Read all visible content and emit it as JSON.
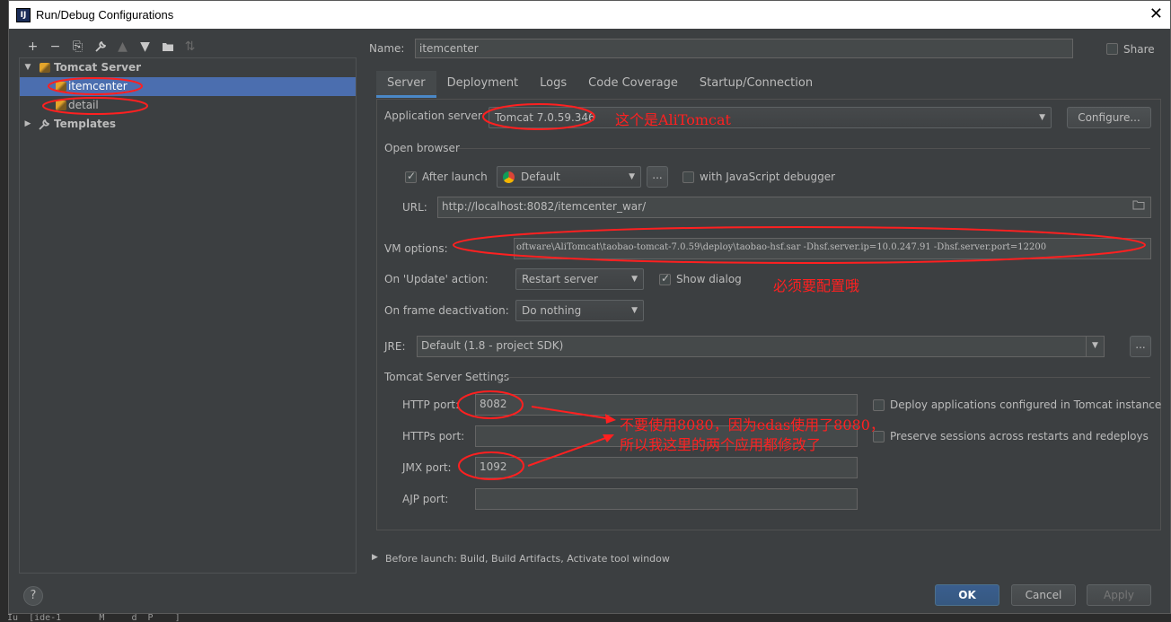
{
  "window": {
    "title": "Run/Debug Configurations",
    "close_glyph": "✕"
  },
  "left_toolbar": [
    "+",
    "−",
    "⎘",
    "🔧",
    "▲",
    "▼",
    "📁",
    "⇅"
  ],
  "tree": {
    "group_label": "Tomcat Server",
    "items": [
      {
        "label": "itemcenter",
        "selected": true
      },
      {
        "label": "detail",
        "selected": false
      }
    ],
    "templates_label": "Templates"
  },
  "name": {
    "label": "Name:",
    "value": "itemcenter"
  },
  "share": {
    "label": "Share",
    "checked": false
  },
  "tabs": [
    "Server",
    "Deployment",
    "Logs",
    "Code Coverage",
    "Startup/Connection"
  ],
  "server": {
    "app_server_label": "Application server:",
    "app_server_value": "Tomcat 7.0.59.346",
    "configure_label": "Configure...",
    "open_browser_label": "Open browser",
    "after_launch_label": "After launch",
    "after_launch_checked": true,
    "browser_value": "Default",
    "ellipsis_label": "...",
    "js_debugger_label": "with JavaScript debugger",
    "js_debugger_checked": false,
    "url_label": "URL:",
    "url_value": "http://localhost:8082/itemcenter_war/",
    "vm_options_label": "VM options:",
    "vm_options_value": "oftware\\AliTomcat\\taobao-tomcat-7.0.59\\deploy\\taobao-hsf.sar  -Dhsf.server.ip=10.0.247.91  -Dhsf.server.port=12200",
    "on_update_label": "On 'Update' action:",
    "on_update_value": "Restart server",
    "show_dialog_label": "Show dialog",
    "show_dialog_checked": true,
    "on_frame_label": "On frame deactivation:",
    "on_frame_value": "Do nothing",
    "jre_label": "JRE:",
    "jre_value": "Default (1.8 - project SDK)",
    "tomcat_settings_label": "Tomcat Server Settings",
    "http_port_label": "HTTP port:",
    "http_port_value": "8082",
    "https_port_label": "HTTPs port:",
    "https_port_value": "",
    "jmx_port_label": "JMX port:",
    "jmx_port_value": "1092",
    "ajp_port_label": "AJP port:",
    "ajp_port_value": "",
    "deploy_apps_label": "Deploy applications configured in Tomcat instance",
    "preserve_sessions_label": "Preserve sessions across restarts and redeploys"
  },
  "before_launch_label": "Before launch: Build, Build Artifacts, Activate tool window",
  "buttons": {
    "ok": "OK",
    "cancel": "Cancel",
    "apply": "Apply",
    "help": "?"
  },
  "annotations": {
    "ali_tomcat": "这个是AliTomcat",
    "must_config": "必须要配置哦",
    "port_note_1": "不要使用8080，因为edas使用了8080，",
    "port_note_2": "所以我这里的两个应用都修改了"
  },
  "background_text": "Iu  [ide-1       M     d  P    ]",
  "colors": {
    "accent": "#4b6eaf",
    "annotation": "#ff2020",
    "background": "#3c3f41"
  }
}
